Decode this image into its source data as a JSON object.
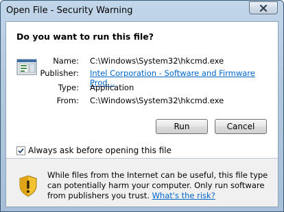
{
  "window": {
    "title": "Open File - Security Warning"
  },
  "dialog": {
    "question": "Do you want to run this file?",
    "fields": {
      "name_label": "Name:",
      "name_value": "C:\\Windows\\System32\\hkcmd.exe",
      "publisher_label": "Publisher:",
      "publisher_value": "Intel Corporation - Software and Firmware Prod...",
      "type_label": "Type:",
      "type_value": "Application",
      "from_label": "From:",
      "from_value": "C:\\Windows\\System32\\hkcmd.exe"
    },
    "buttons": {
      "run": "Run",
      "cancel": "Cancel"
    },
    "checkbox": {
      "label": "Always ask before opening this file",
      "checked": true
    },
    "warning": {
      "text": "While files from the Internet can be useful, this file type can potentially harm your computer. Only run software from publishers you trust.",
      "link": "What's the risk?"
    }
  },
  "colors": {
    "link": "#0066cc",
    "shield": "#e8b01c"
  },
  "icons": {
    "close": "close-icon",
    "file": "application-file-icon",
    "shield": "security-shield-icon"
  }
}
